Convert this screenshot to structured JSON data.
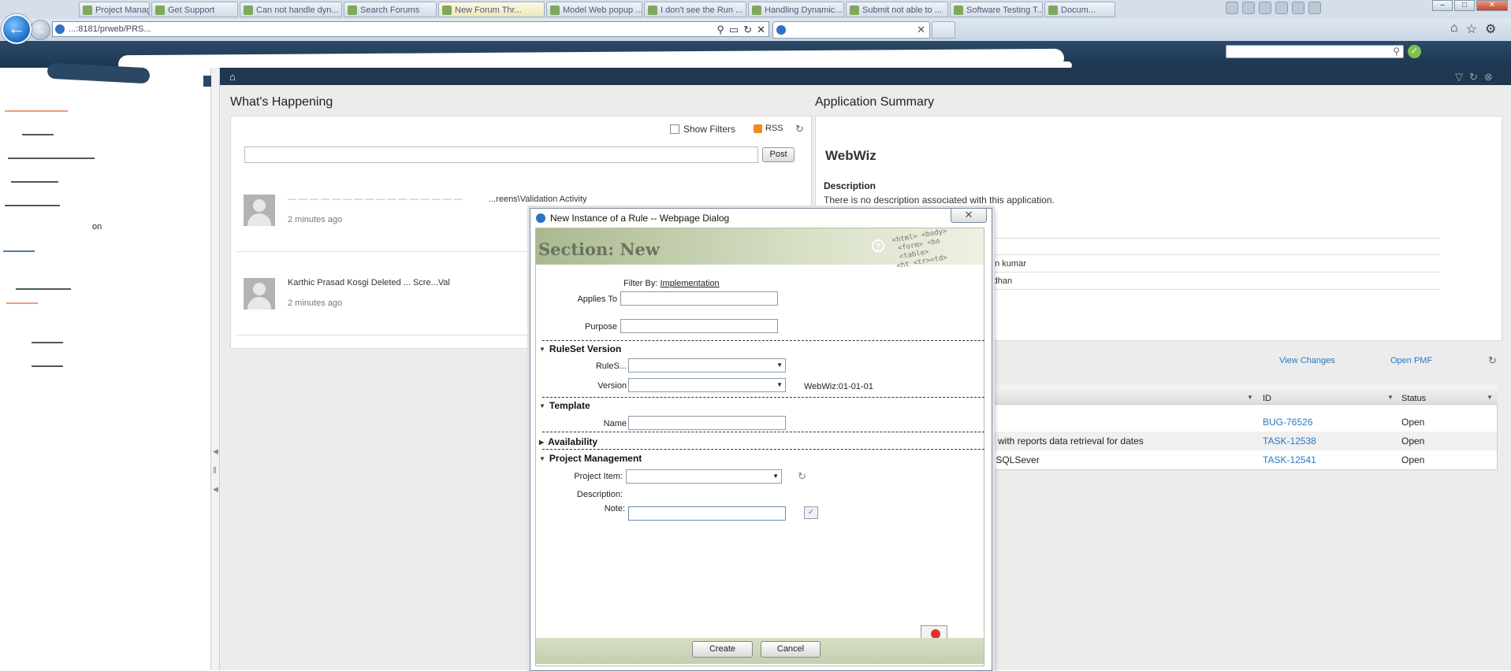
{
  "browser": {
    "tabs": [
      "Project Manageme...",
      "Get Support",
      "Can not handle dyn...",
      "Search Forums",
      "New Forum Thr...",
      "Model Web popup ...",
      "I don't see the Run ...",
      "Handling Dynamic...",
      "Submit not able to ...",
      "Software Testing T...",
      "Docum..."
    ],
    "active_tab_index": 4,
    "address_url": "...:8181/prweb/PRS...",
    "page_tab_title": "",
    "icons": [
      "lock-icon",
      "star-icon",
      "home-icon",
      "gear-icon"
    ]
  },
  "header": {
    "username": "",
    "search_placeholder": ""
  },
  "leftnav": {
    "fragment": "on"
  },
  "whats_happening": {
    "title": "What's Happening",
    "show_filters_label": "Show Filters",
    "rss_label": "RSS",
    "post_button": "Post",
    "post_placeholder": "",
    "feed": [
      {
        "text": "...reens\\Validation Activity",
        "time": "2 minutes ago"
      },
      {
        "text": "Karthic Prasad Kosgi Deleted ... Scre...Val",
        "time": "2 minutes ago"
      }
    ]
  },
  "app_summary": {
    "title": "Application Summary",
    "app_name": "WebWiz",
    "description_label": "Description",
    "description_text": "There is no description associated with this application.",
    "rows": [
      "an kumar",
      "rdhan"
    ]
  },
  "worklist": {
    "view_changes": "View Changes",
    "open_pmf": "Open PMF",
    "columns": [
      "",
      "ID",
      "Status"
    ],
    "rows": [
      {
        "desc": "",
        "id": "BUG-76526",
        "status": "Open"
      },
      {
        "desc": "e with reports data retrieval for dates",
        "id": "TASK-12538",
        "status": "Open"
      },
      {
        "desc": "r SQLSever",
        "id": "TASK-12541",
        "status": "Open"
      }
    ]
  },
  "dialog": {
    "title": "New Instance of a Rule -- Webpage Dialog",
    "heading": "Section: New",
    "filter_by_label": "Filter By:",
    "filter_by_value": "Implementation",
    "applies_to_label": "Applies To",
    "purpose_label": "Purpose",
    "ruleset_section": "RuleSet Version",
    "ruleset_label": "RuleS...",
    "version_label": "Version",
    "version_value": "WebWiz:01-01-01",
    "template_section": "Template",
    "name_label": "Name",
    "availability_section": "Availability",
    "pm_section": "Project Management",
    "project_item_label": "Project Item:",
    "description_label": "Description:",
    "note_label": "Note:",
    "create_button": "Create",
    "cancel_button": "Cancel",
    "code_art": "<html> <body>\n <form> <bo\n <table>\n<ht <tr><td>"
  }
}
